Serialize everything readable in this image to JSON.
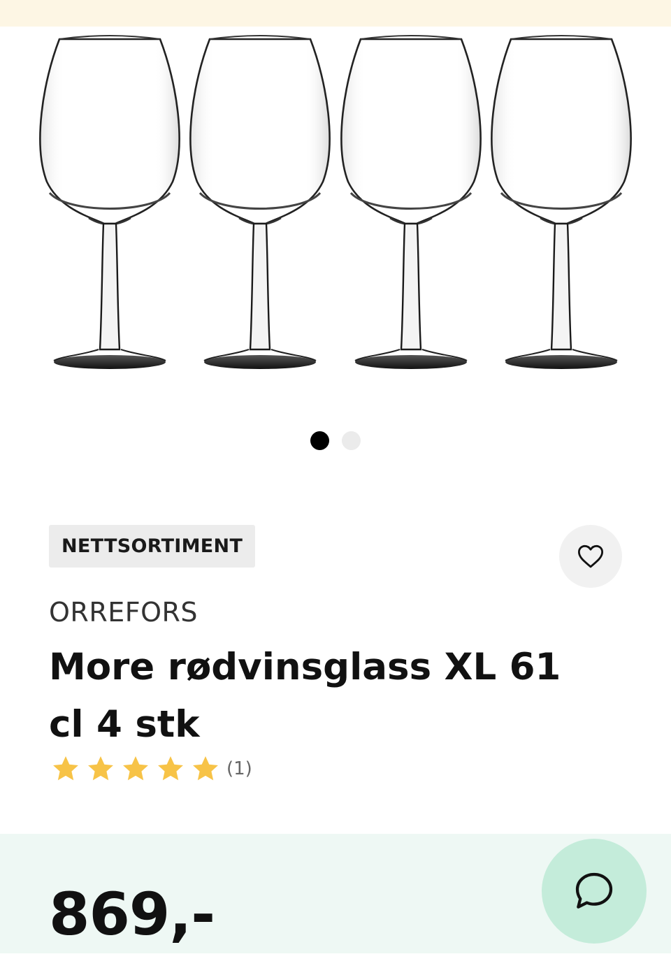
{
  "product": {
    "badge": "NETTSORTIMENT",
    "brand": "ORREFORS",
    "title": "More rødvinsglass XL 61 cl 4 stk",
    "rating": {
      "stars": 5,
      "max_stars": 5,
      "count_label": "(1)"
    },
    "price": "869,-"
  },
  "gallery": {
    "slides": 2,
    "active_slide": 1
  },
  "icons": {
    "favorite": "heart-icon",
    "chat": "chat-bubble-icon",
    "rating": "star-icon"
  },
  "colors": {
    "top_strip": "#fdf6e4",
    "badge_bg": "#ececec",
    "price_panel": "#eef8f4",
    "chat_button": "#c4ecda",
    "star": "#f7c347",
    "dot_active": "#000000",
    "dot_inactive": "#ebebeb"
  }
}
